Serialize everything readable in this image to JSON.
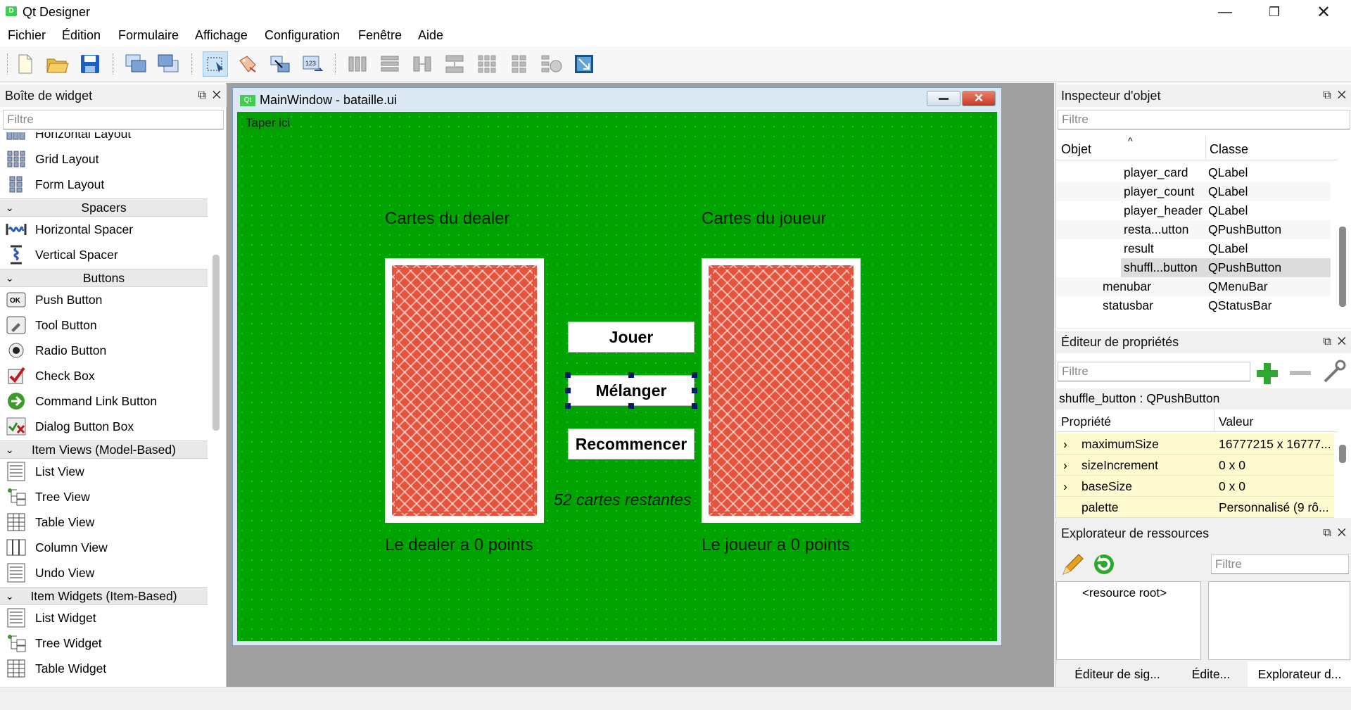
{
  "window": {
    "title": "Qt Designer",
    "app_icon": "D"
  },
  "menu": [
    "Fichier",
    "Édition",
    "Formulaire",
    "Affichage",
    "Configuration",
    "Fenêtre",
    "Aide"
  ],
  "toolbar": {
    "icons": [
      "new-file-icon",
      "open-folder-icon",
      "save-icon",
      "send-to-back-icon",
      "bring-to-front-icon",
      "edit-widgets-icon",
      "edit-signals-slots-icon",
      "edit-buddies-icon",
      "edit-tab-order-icon",
      "layout-horizontal-icon",
      "layout-vertical-icon",
      "layout-horizontal-splitter-icon",
      "layout-vertical-splitter-icon",
      "layout-grid-icon",
      "layout-form-icon",
      "break-layout-icon",
      "adjust-size-icon"
    ]
  },
  "widget_box": {
    "title": "Boîte de widget",
    "filter_placeholder": "Filtre",
    "items": [
      {
        "label": "Horizontal Layout",
        "icon": "horizontal-layout-icon"
      },
      {
        "label": "Grid Layout",
        "icon": "grid-layout-icon"
      },
      {
        "label": "Form Layout",
        "icon": "form-layout-icon"
      },
      {
        "category": "Spacers"
      },
      {
        "label": "Horizontal Spacer",
        "icon": "horizontal-spacer-icon"
      },
      {
        "label": "Vertical Spacer",
        "icon": "vertical-spacer-icon"
      },
      {
        "category": "Buttons"
      },
      {
        "label": "Push Button",
        "icon": "push-button-icon"
      },
      {
        "label": "Tool Button",
        "icon": "tool-button-icon"
      },
      {
        "label": "Radio Button",
        "icon": "radio-button-icon"
      },
      {
        "label": "Check Box",
        "icon": "check-box-icon"
      },
      {
        "label": "Command Link Button",
        "icon": "command-link-icon"
      },
      {
        "label": "Dialog Button Box",
        "icon": "dialog-button-box-icon"
      },
      {
        "category": "Item Views (Model-Based)"
      },
      {
        "label": "List View",
        "icon": "list-view-icon"
      },
      {
        "label": "Tree View",
        "icon": "tree-view-icon"
      },
      {
        "label": "Table View",
        "icon": "table-view-icon"
      },
      {
        "label": "Column View",
        "icon": "column-view-icon"
      },
      {
        "label": "Undo View",
        "icon": "undo-view-icon"
      },
      {
        "category": "Item Widgets (Item-Based)"
      },
      {
        "label": "List Widget",
        "icon": "list-widget-icon"
      },
      {
        "label": "Tree Widget",
        "icon": "tree-widget-icon"
      },
      {
        "label": "Table Widget",
        "icon": "table-widget-icon"
      }
    ]
  },
  "form": {
    "window_title": "MainWindow - bataille.ui",
    "window_icon": "Qt",
    "menu_placeholder": "Taper ici",
    "dealer_header": "Cartes du dealer",
    "player_header": "Cartes du joueur",
    "play_button": "Jouer",
    "shuffle_button": "Mélanger",
    "restart_button": "Recommencer",
    "remaining": "52 cartes restantes",
    "dealer_points": "Le dealer a 0 points",
    "player_points": "Le joueur a 0 points",
    "background_color": "#00a400",
    "card_color": "#e6533d"
  },
  "object_inspector": {
    "title": "Inspecteur d'objet",
    "filter_placeholder": "Filtre",
    "col_object": "Objet",
    "col_class": "Classe",
    "rows": [
      {
        "object": "player_card",
        "class": "QLabel"
      },
      {
        "object": "player_count",
        "class": "QLabel"
      },
      {
        "object": "player_header",
        "class": "QLabel"
      },
      {
        "object": "resta...utton",
        "class": "QPushButton"
      },
      {
        "object": "result",
        "class": "QLabel"
      },
      {
        "object": "shuffl...button",
        "class": "QPushButton"
      },
      {
        "object": "menubar",
        "class": "QMenuBar"
      },
      {
        "object": "statusbar",
        "class": "QStatusBar"
      }
    ]
  },
  "property_editor": {
    "title": "Éditeur de propriétés",
    "filter_placeholder": "Filtre",
    "object_label": "shuffle_button : QPushButton",
    "col_property": "Propriété",
    "col_value": "Valeur",
    "rows": [
      {
        "property": "maximumSize",
        "value": "16777215 x 16777..."
      },
      {
        "property": "sizeIncrement",
        "value": "0 x 0"
      },
      {
        "property": "baseSize",
        "value": "0 x 0"
      },
      {
        "property": "palette",
        "value": "Personnalisé (9 rô..."
      }
    ]
  },
  "resource_browser": {
    "title": "Explorateur de ressources",
    "filter_placeholder": "Filtre",
    "root": "<resource root>"
  },
  "bottom_tabs": [
    "Éditeur de sig...",
    "Édite...",
    "Explorateur d..."
  ]
}
